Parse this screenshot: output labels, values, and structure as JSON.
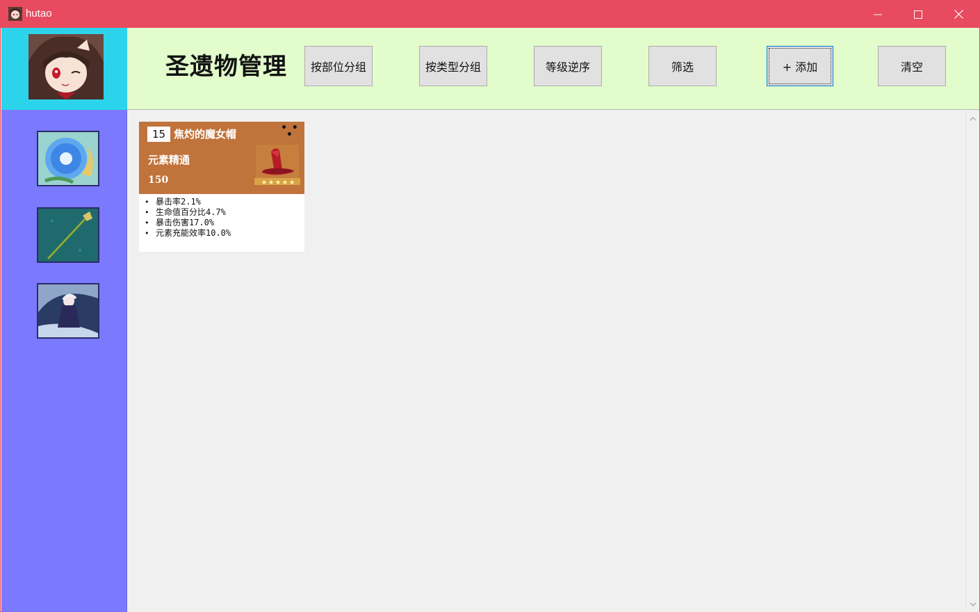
{
  "window": {
    "title": "hutao",
    "app_icon": "hutao-avatar-icon",
    "controls": [
      "minimize-icon",
      "maximize-icon",
      "close-icon"
    ],
    "accent_color": "#e84a5f"
  },
  "header": {
    "title": "圣遗物管理",
    "background": "#e2fccb",
    "buttons": [
      {
        "label": "按部位分组"
      },
      {
        "label": "按类型分组"
      },
      {
        "label": "等级逆序"
      },
      {
        "label": "筛选"
      },
      {
        "label": "+ 添加"
      },
      {
        "label": "清空"
      }
    ]
  },
  "sidebar": {
    "background": "#7b79fe",
    "items": [
      {
        "icon": "flower-icon"
      },
      {
        "icon": "weapon-staff-icon"
      },
      {
        "icon": "character-icon"
      }
    ]
  },
  "artifacts": [
    {
      "level": "15",
      "name": "焦灼的魔女帽",
      "more": "• • •",
      "main_stat": "元素精通",
      "main_value": "150",
      "rarity_stars": 5,
      "image_icon": "witch-hat-icon",
      "substats": [
        "暴击率2.1%",
        "生命值百分比4.7%",
        "暴击伤害17.0%",
        "元素充能效率10.0%"
      ]
    }
  ]
}
